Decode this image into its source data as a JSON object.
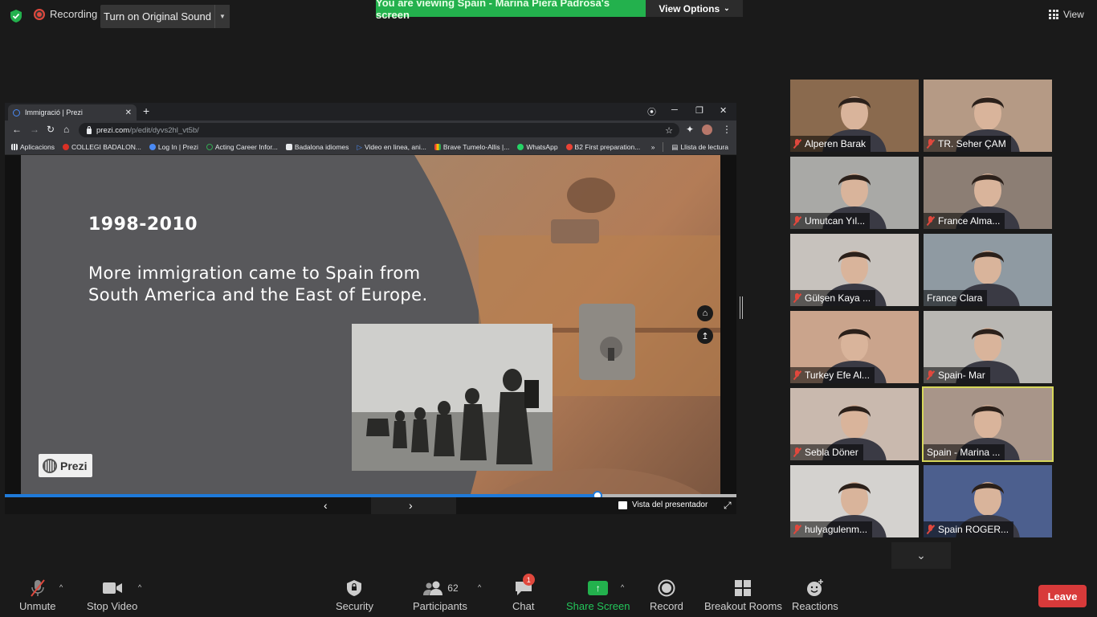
{
  "topbar": {
    "recording_label": "Recording",
    "original_sound_label": "Turn on Original Sound",
    "viewing_banner": "You are viewing Spain - Marina Piera Padrosa's screen",
    "view_options_label": "View Options",
    "view_label": "View"
  },
  "browser": {
    "tab_title": "Immigració | Prezi",
    "url_host": "prezi.com",
    "url_path": "/p/edit/dyvs2hl_vt5b/",
    "bookmarks": [
      {
        "label": "Aplicacions",
        "color": "#e8eaed"
      },
      {
        "label": "COLLEGI BADALON...",
        "color": "#d93025"
      },
      {
        "label": "Log In | Prezi",
        "color": "#4a8af4"
      },
      {
        "label": "Acting Career Infor...",
        "color": "#34a853"
      },
      {
        "label": "Badalona idiomes",
        "color": "#e8eaed"
      },
      {
        "label": "Video en linea, ani...",
        "color": "#4a8af4"
      },
      {
        "label": "Brave Tumelo-Allis |...",
        "color": "#fbbc04"
      },
      {
        "label": "WhatsApp",
        "color": "#25d366"
      },
      {
        "label": "B2 First preparation...",
        "color": "#ea4335"
      }
    ],
    "reading_list": "Llista de lectura"
  },
  "slide": {
    "year": "1998-2010",
    "body": "More immigration came to Spain from South America and the East of Europe.",
    "badge": "Prezi",
    "progress": 0.81,
    "presenter_view": "Vista del presentador"
  },
  "participants": [
    {
      "name": "Alperen Barak",
      "muted": true,
      "bg": "#8a6a4e"
    },
    {
      "name": "TR. Seher ÇAM",
      "muted": true,
      "bg": "#b59a85"
    },
    {
      "name": "Umutcan Yıl...",
      "muted": true,
      "bg": "#a9a9a6"
    },
    {
      "name": "France Alma...",
      "muted": true,
      "bg": "#8c7e74"
    },
    {
      "name": "Gülşen Kaya ...",
      "muted": true,
      "bg": "#c7c2bd"
    },
    {
      "name": "France Clara",
      "muted": false,
      "bg": "#8f9aa2"
    },
    {
      "name": "Turkey Efe Al...",
      "muted": true,
      "bg": "#caa48c"
    },
    {
      "name": "Spain- Mar",
      "muted": true,
      "bg": "#b9b7b3"
    },
    {
      "name": "Sebla Döner",
      "muted": true,
      "bg": "#c9b9ae"
    },
    {
      "name": "Spain - Marina ...",
      "muted": false,
      "bg": "#a89589",
      "active": true
    },
    {
      "name": "hulyagulenm...",
      "muted": true,
      "bg": "#d4d2cf"
    },
    {
      "name": "Spain ROGER...",
      "muted": true,
      "bg": "#4c5f8e"
    }
  ],
  "bottombar": {
    "unmute": "Unmute",
    "stop_video": "Stop Video",
    "security": "Security",
    "participants": "Participants",
    "participants_count": "62",
    "chat": "Chat",
    "chat_badge": "1",
    "share_screen": "Share Screen",
    "record": "Record",
    "breakout_rooms": "Breakout Rooms",
    "reactions": "Reactions",
    "leave": "Leave"
  },
  "colors": {
    "viewing_banner": "#23b14d",
    "leave": "#d83a3a",
    "prezi_progress": "#1f7ad9",
    "active_speaker": "#d7d75a"
  }
}
